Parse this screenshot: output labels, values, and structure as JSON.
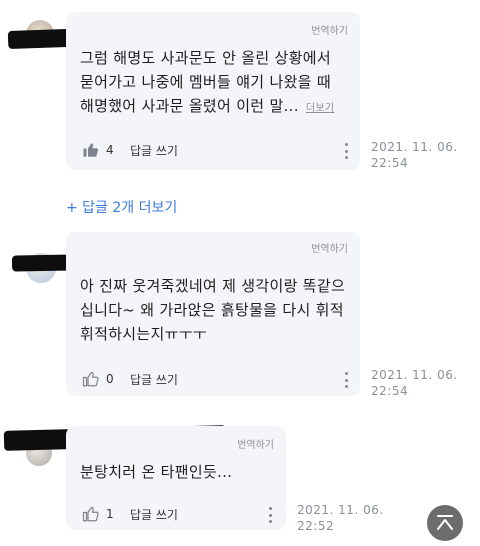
{
  "comments": [
    {
      "translate_label": "번역하기",
      "text_lines": [
        "그럼 해명도 사과문도 안 올린 상황에서",
        "묻어가고 나중에 멤버들 얘기 나왔을 때",
        "해명했어 사과문 올렸어 이런 말..."
      ],
      "more_label": "더보기",
      "like_count": "4",
      "reply_label": "답글 쓰기",
      "timestamp_date": "2021. 11. 06.",
      "timestamp_time": "22:54",
      "liked": true
    },
    {
      "translate_label": "번역하기",
      "text_lines": [
        "아 진짜 웃겨죽겠네여 제 생각이랑 똑같으",
        "십니다~ 왜 가라앉은 흙탕물을 다시 휘적",
        "휘적하시는지ㅠㅜㅜ"
      ],
      "like_count": "0",
      "reply_label": "답글 쓰기",
      "timestamp_date": "2021. 11. 06.",
      "timestamp_time": "22:54",
      "liked": false
    },
    {
      "translate_label": "번역하기",
      "text_lines": [
        "분탕치러 온 타팬인듯..."
      ],
      "like_count": "1",
      "reply_label": "답글 쓰기",
      "timestamp_date": "2021. 11. 06.",
      "timestamp_time": "22:52",
      "liked": false
    }
  ],
  "more_replies_label": "+ 답글 2개 더보기",
  "icons": {
    "like": "thumbs-up-icon",
    "menu": "more-vertical-icon",
    "scroll_top": "scroll-to-top-icon"
  },
  "colors": {
    "link_blue": "#3f7bdc",
    "bubble_bg": "#f4f5f8",
    "muted_text": "#8a8f99"
  }
}
